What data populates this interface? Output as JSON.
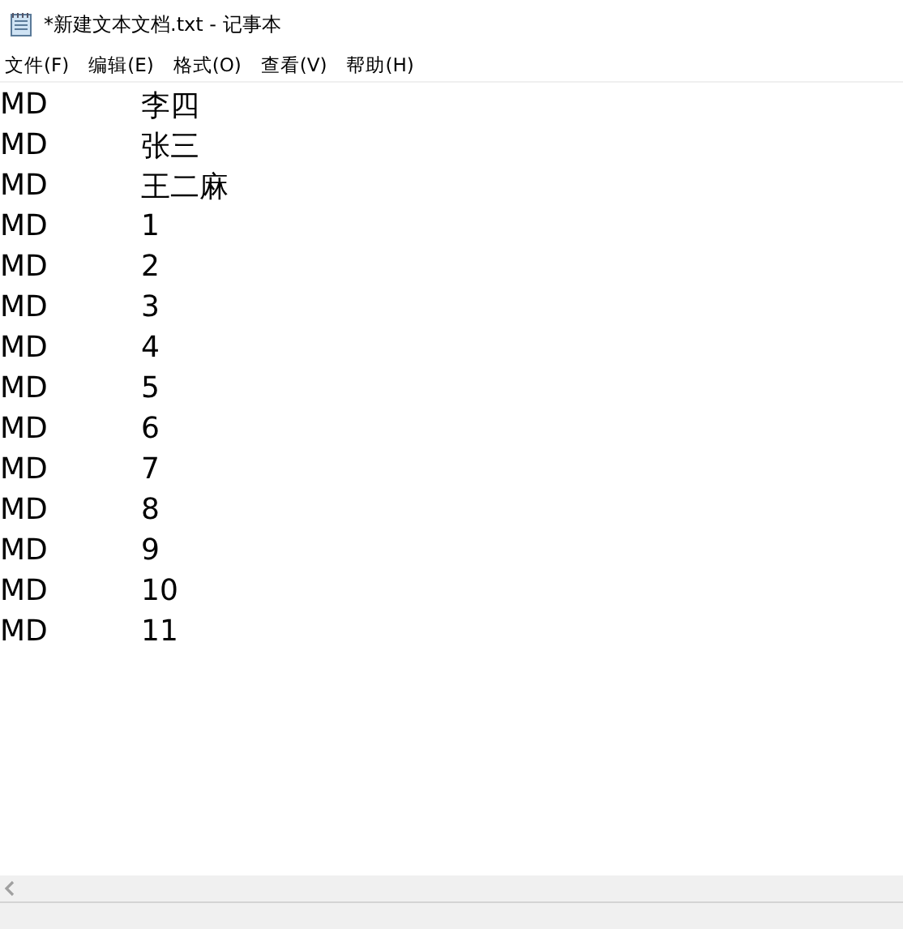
{
  "window": {
    "title": "*新建文本文档.txt - 记事本"
  },
  "menu": [
    "文件(F)",
    "编辑(E)",
    "格式(O)",
    "查看(V)",
    "帮助(H)"
  ],
  "lines": [
    {
      "col_1": "MD",
      "col_2": "李四"
    },
    {
      "col_1": "MD",
      "col_2": "张三"
    },
    {
      "col_1": "MD",
      "col_2": "王二麻"
    },
    {
      "col_1": "MD",
      "col_2": "1"
    },
    {
      "col_1": "MD",
      "col_2": "2"
    },
    {
      "col_1": "MD",
      "col_2": "3"
    },
    {
      "col_1": "MD",
      "col_2": "4"
    },
    {
      "col_1": "MD",
      "col_2": "5"
    },
    {
      "col_1": "MD",
      "col_2": "6"
    },
    {
      "col_1": "MD",
      "col_2": "7"
    },
    {
      "col_1": "MD",
      "col_2": "8"
    },
    {
      "col_1": "MD",
      "col_2": "9"
    },
    {
      "col_1": "MD",
      "col_2": "10"
    },
    {
      "col_1": "MD",
      "col_2": "11"
    }
  ]
}
